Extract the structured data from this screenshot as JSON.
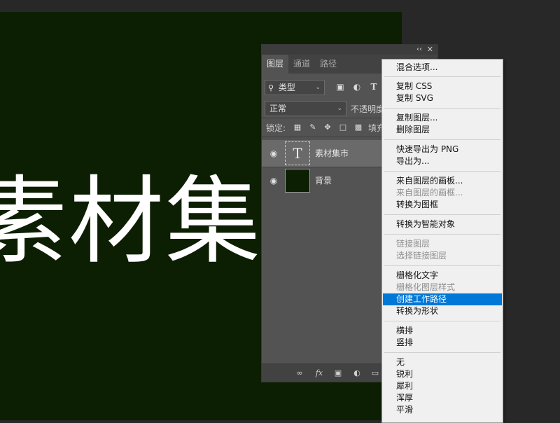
{
  "canvas": {
    "text": "素材集",
    "background": "#0c1f02"
  },
  "panel": {
    "collapse_glyph": "‹‹",
    "close_glyph": "✕",
    "tabs": [
      {
        "label": "图层",
        "active": true
      },
      {
        "label": "通道",
        "active": false
      },
      {
        "label": "路径",
        "active": false
      }
    ],
    "filter": {
      "value": "类型",
      "icon": "search-icon"
    },
    "filter_text_glyph": "T",
    "blend": {
      "value": "正常",
      "opacity_label": "不透明度"
    },
    "lock": {
      "label": "锁定:",
      "fill_label": "填充"
    },
    "layers": [
      {
        "name": "素材集市",
        "type": "text",
        "thumb_glyph": "T",
        "selected": true,
        "visible": true
      },
      {
        "name": "背景",
        "type": "image",
        "selected": false,
        "visible": true
      }
    ],
    "bottom_fx": "fx"
  },
  "context_menu": {
    "highlight_color": "#0078d7",
    "items": [
      {
        "label": "混合选项...",
        "state": "normal"
      },
      {
        "label": "复制 CSS",
        "state": "normal"
      },
      {
        "label": "复制 SVG",
        "state": "normal"
      },
      {
        "label": "复制图层...",
        "state": "normal"
      },
      {
        "label": "删除图层",
        "state": "normal"
      },
      {
        "label": "快速导出为 PNG",
        "state": "normal"
      },
      {
        "label": "导出为...",
        "state": "normal"
      },
      {
        "label": "来自图层的画板...",
        "state": "normal"
      },
      {
        "label": "来自图层的画框...",
        "state": "disabled"
      },
      {
        "label": "转换为图框",
        "state": "normal"
      },
      {
        "label": "转换为智能对象",
        "state": "normal"
      },
      {
        "label": "链接图层",
        "state": "disabled"
      },
      {
        "label": "选择链接图层",
        "state": "disabled"
      },
      {
        "label": "栅格化文字",
        "state": "normal"
      },
      {
        "label": "栅格化图层样式",
        "state": "disabled"
      },
      {
        "label": "创建工作路径",
        "state": "highlighted"
      },
      {
        "label": "转换为形状",
        "state": "normal"
      },
      {
        "label": "横排",
        "state": "normal"
      },
      {
        "label": "竖排",
        "state": "normal"
      },
      {
        "label": "无",
        "state": "normal"
      },
      {
        "label": "锐利",
        "state": "normal"
      },
      {
        "label": "犀利",
        "state": "normal"
      },
      {
        "label": "浑厚",
        "state": "normal"
      },
      {
        "label": "平滑",
        "state": "normal"
      }
    ]
  }
}
